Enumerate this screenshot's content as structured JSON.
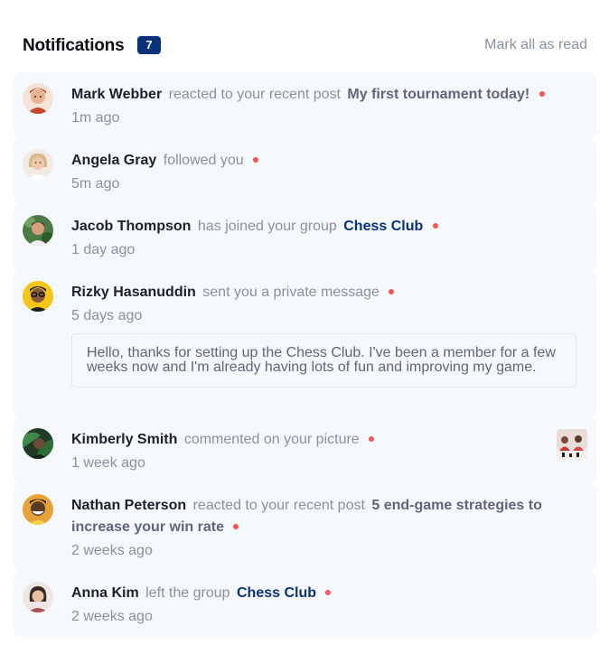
{
  "header": {
    "title": "Notifications",
    "unread_count": "7",
    "mark_all_label": "Mark all as read"
  },
  "notifications": [
    {
      "user": "Mark Webber",
      "action": "reacted to your recent post",
      "post": "My first tournament today!",
      "time": "1m ago",
      "unread": true
    },
    {
      "user": "Angela Gray",
      "action": "followed you",
      "time": "5m ago",
      "unread": true
    },
    {
      "user": "Jacob Thompson",
      "action": "has joined your group",
      "group": "Chess Club",
      "time": "1 day ago",
      "unread": true
    },
    {
      "user": "Rizky Hasanuddin",
      "action": "sent you a private message",
      "time": "5 days ago",
      "unread": true,
      "message": "Hello, thanks for setting up the Chess Club. I've been a member for a few weeks now and I'm already having lots of fun and improving my game."
    },
    {
      "user": "Kimberly Smith",
      "action": "commented on your picture",
      "time": "1 week ago",
      "unread": true
    },
    {
      "user": "Nathan Peterson",
      "action": "reacted to your recent post",
      "post": "5 end-game strategies to increase your win rate",
      "time": "2 weeks ago",
      "unread": true
    },
    {
      "user": "Anna Kim",
      "action": "left the group",
      "group": "Chess Club",
      "time": "2 weeks ago",
      "unread": true
    }
  ],
  "colors": {
    "accent": "#0a327b",
    "unread_dot": "#f65552",
    "item_background": "#f5f8fc",
    "muted_text": "#8a919e"
  }
}
